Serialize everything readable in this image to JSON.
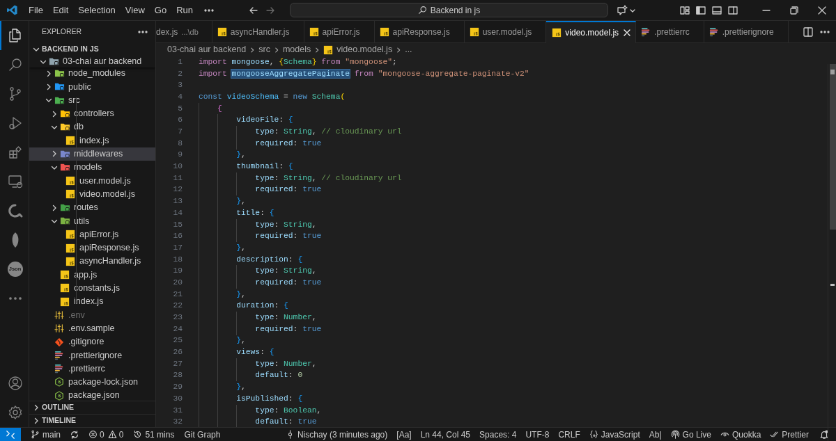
{
  "title_bar": {
    "menus": [
      "File",
      "Edit",
      "Selection",
      "View",
      "Go",
      "Run"
    ],
    "search": "Backend in js"
  },
  "activity_bar": {
    "top": [
      {
        "kind": "explorer",
        "selected": true
      },
      {
        "kind": "search",
        "selected": false
      },
      {
        "kind": "source-control",
        "selected": false
      },
      {
        "kind": "run-debug",
        "selected": false
      },
      {
        "kind": "extensions",
        "selected": false
      },
      {
        "kind": "remote",
        "selected": false
      },
      {
        "kind": "quokka",
        "selected": false
      },
      {
        "kind": "leaf",
        "selected": false
      },
      {
        "kind": "json",
        "label": "Json",
        "selected": false
      },
      {
        "kind": "more",
        "selected": false
      }
    ],
    "bottom": [
      {
        "kind": "account",
        "selected": false
      },
      {
        "kind": "settings",
        "selected": false
      }
    ]
  },
  "sidebar": {
    "title": "EXPLORER",
    "root": "BACKEND IN JS",
    "tree": [
      {
        "label": "03-chai aur backend",
        "kind": "folder",
        "color": "#90a4ae",
        "expanded": true,
        "selected": false,
        "dimmed": false,
        "children": [
          {
            "label": "node_modules",
            "kind": "folder",
            "color": "#8bc34a",
            "expanded": false,
            "selected": false,
            "dimmed": false
          },
          {
            "label": "public",
            "kind": "folder",
            "color": "#2196f3",
            "expanded": false,
            "selected": false,
            "dimmed": false
          },
          {
            "label": "src",
            "kind": "folder",
            "color": "#4caf50",
            "expanded": true,
            "selected": false,
            "dimmed": false,
            "children": [
              {
                "label": "controllers",
                "kind": "folder",
                "color": "#ffc107",
                "expanded": false,
                "selected": false,
                "dimmed": false
              },
              {
                "label": "db",
                "kind": "folder",
                "color": "#ffca28",
                "expanded": true,
                "selected": false,
                "dimmed": false,
                "children": [
                  {
                    "label": "index.js",
                    "kind": "js",
                    "selected": false,
                    "dimmed": false
                  }
                ]
              },
              {
                "label": "middlewares",
                "kind": "folder",
                "color": "#7986cb",
                "expanded": false,
                "selected": true,
                "dimmed": false
              },
              {
                "label": "models",
                "kind": "folder",
                "color": "#ef5350",
                "expanded": true,
                "selected": false,
                "dimmed": false,
                "children": [
                  {
                    "label": "user.model.js",
                    "kind": "js",
                    "selected": false,
                    "dimmed": false
                  },
                  {
                    "label": "video.model.js",
                    "kind": "js",
                    "selected": false,
                    "dimmed": false
                  }
                ]
              },
              {
                "label": "routes",
                "kind": "folder",
                "color": "#43a047",
                "expanded": false,
                "selected": false,
                "dimmed": false
              },
              {
                "label": "utils",
                "kind": "folder",
                "color": "#7cb342",
                "expanded": true,
                "selected": false,
                "dimmed": false,
                "children": [
                  {
                    "label": "apiError.js",
                    "kind": "js",
                    "selected": false,
                    "dimmed": false
                  },
                  {
                    "label": "apiResponse.js",
                    "kind": "js",
                    "selected": false,
                    "dimmed": false
                  },
                  {
                    "label": "asyncHandler.js",
                    "kind": "js",
                    "selected": false,
                    "dimmed": false
                  }
                ]
              },
              {
                "label": "app.js",
                "kind": "js",
                "selected": false,
                "dimmed": false
              },
              {
                "label": "constants.js",
                "kind": "js",
                "selected": false,
                "dimmed": false
              },
              {
                "label": "index.js",
                "kind": "js",
                "selected": false,
                "dimmed": false
              }
            ]
          },
          {
            "label": ".env",
            "kind": "env",
            "selected": false,
            "dimmed": true
          },
          {
            "label": ".env.sample",
            "kind": "env",
            "selected": false,
            "dimmed": false
          },
          {
            "label": ".gitignore",
            "kind": "git",
            "selected": false,
            "dimmed": false
          },
          {
            "label": ".prettierignore",
            "kind": "prettier",
            "selected": false,
            "dimmed": false
          },
          {
            "label": ".prettierrc",
            "kind": "prettier",
            "selected": false,
            "dimmed": false
          },
          {
            "label": "package-lock.json",
            "kind": "json",
            "selected": false,
            "dimmed": false
          },
          {
            "label": "package.json",
            "kind": "json",
            "selected": false,
            "dimmed": false
          }
        ]
      }
    ],
    "sections": [
      {
        "label": "OUTLINE",
        "expanded": false
      },
      {
        "label": "TIMELINE",
        "expanded": false
      }
    ]
  },
  "tabs": [
    {
      "label": "dex.js",
      "description": "...\\db",
      "kind": "partial",
      "selected": false
    },
    {
      "label": "asyncHandler.js",
      "kind": "js",
      "selected": false
    },
    {
      "label": "apiError.js",
      "kind": "js",
      "selected": false
    },
    {
      "label": "apiResponse.js",
      "kind": "js",
      "selected": false
    },
    {
      "label": "user.model.js",
      "kind": "js",
      "selected": false
    },
    {
      "label": "video.model.js",
      "kind": "js",
      "selected": true
    },
    {
      "label": ".prettierrc",
      "kind": "prettier",
      "selected": false
    },
    {
      "label": ".prettierignore",
      "kind": "prettier",
      "selected": false
    }
  ],
  "breadcrumbs": [
    {
      "text": "03-chai aur backend",
      "kind": "folder"
    },
    {
      "text": "src",
      "kind": "folder"
    },
    {
      "text": "models",
      "kind": "folder"
    },
    {
      "text": "video.model.js",
      "kind": "js"
    },
    {
      "text": "...",
      "kind": "symbol"
    }
  ],
  "code_lines": [
    {
      "number": "1",
      "tokens": [
        {
          "kind": "keyword",
          "text": "import "
        },
        {
          "kind": "variable",
          "text": "mongoose"
        },
        {
          "kind": "punct",
          "text": ", "
        },
        {
          "kind": "bracket1",
          "text": "{"
        },
        {
          "kind": "type",
          "text": "Schema"
        },
        {
          "kind": "bracket1",
          "text": "}"
        },
        {
          "kind": "keyword",
          "text": " from "
        },
        {
          "kind": "string",
          "text": "\"mongoose\""
        },
        {
          "kind": "punct",
          "text": ";"
        }
      ]
    },
    {
      "number": "2",
      "tokens": [
        {
          "kind": "keyword",
          "text": "import "
        },
        {
          "kind": "match",
          "text": "mongooseAggregatePaginate"
        },
        {
          "kind": "keyword",
          "text": " from "
        },
        {
          "kind": "string",
          "text": "\"mongoose-aggregate-paginate-v2\""
        }
      ]
    },
    {
      "number": "3"
    },
    {
      "number": "4",
      "tokens": [
        {
          "kind": "storage",
          "text": "const "
        },
        {
          "kind": "constant",
          "text": "videoSchema"
        },
        {
          "kind": "punct",
          "text": " = "
        },
        {
          "kind": "storage",
          "text": "new "
        },
        {
          "kind": "type",
          "text": "Schema"
        },
        {
          "kind": "bracket1",
          "text": "("
        }
      ]
    },
    {
      "number": "5",
      "tokens": [
        {
          "kind": "bracket2",
          "text": "    {"
        }
      ]
    },
    {
      "number": "6",
      "tokens": [
        {
          "kind": "property",
          "text": "        videoFile"
        },
        {
          "kind": "punct",
          "text": ": "
        },
        {
          "kind": "bracket3",
          "text": "{"
        }
      ]
    },
    {
      "number": "7",
      "tokens": [
        {
          "kind": "property",
          "text": "            type"
        },
        {
          "kind": "punct",
          "text": ": "
        },
        {
          "kind": "type",
          "text": "String"
        },
        {
          "kind": "punct",
          "text": ", "
        },
        {
          "kind": "comment",
          "text": "// cloudinary url"
        }
      ]
    },
    {
      "number": "8",
      "tokens": [
        {
          "kind": "property",
          "text": "            required"
        },
        {
          "kind": "punct",
          "text": ": "
        },
        {
          "kind": "boolean",
          "text": "true"
        }
      ]
    },
    {
      "number": "9",
      "tokens": [
        {
          "kind": "bracket3",
          "text": "        }"
        },
        {
          "kind": "punct",
          "text": ","
        }
      ]
    },
    {
      "number": "10",
      "tokens": [
        {
          "kind": "property",
          "text": "        thumbnail"
        },
        {
          "kind": "punct",
          "text": ": "
        },
        {
          "kind": "bracket3",
          "text": "{"
        }
      ]
    },
    {
      "number": "11",
      "tokens": [
        {
          "kind": "property",
          "text": "            type"
        },
        {
          "kind": "punct",
          "text": ": "
        },
        {
          "kind": "type",
          "text": "String"
        },
        {
          "kind": "punct",
          "text": ", "
        },
        {
          "kind": "comment",
          "text": "// cloudinary url"
        }
      ]
    },
    {
      "number": "12",
      "tokens": [
        {
          "kind": "property",
          "text": "            required"
        },
        {
          "kind": "punct",
          "text": ": "
        },
        {
          "kind": "boolean",
          "text": "true"
        }
      ]
    },
    {
      "number": "13",
      "tokens": [
        {
          "kind": "bracket3",
          "text": "        }"
        },
        {
          "kind": "punct",
          "text": ","
        }
      ]
    },
    {
      "number": "14",
      "tokens": [
        {
          "kind": "property",
          "text": "        title"
        },
        {
          "kind": "punct",
          "text": ": "
        },
        {
          "kind": "bracket3",
          "text": "{"
        }
      ]
    },
    {
      "number": "15",
      "tokens": [
        {
          "kind": "property",
          "text": "            type"
        },
        {
          "kind": "punct",
          "text": ": "
        },
        {
          "kind": "type",
          "text": "String"
        },
        {
          "kind": "punct",
          "text": ","
        }
      ]
    },
    {
      "number": "16",
      "tokens": [
        {
          "kind": "property",
          "text": "            required"
        },
        {
          "kind": "punct",
          "text": ": "
        },
        {
          "kind": "boolean",
          "text": "true"
        }
      ]
    },
    {
      "number": "17",
      "tokens": [
        {
          "kind": "bracket3",
          "text": "        }"
        },
        {
          "kind": "punct",
          "text": ","
        }
      ]
    },
    {
      "number": "18",
      "tokens": [
        {
          "kind": "property",
          "text": "        description"
        },
        {
          "kind": "punct",
          "text": ": "
        },
        {
          "kind": "bracket3",
          "text": "{"
        }
      ]
    },
    {
      "number": "19",
      "tokens": [
        {
          "kind": "property",
          "text": "            type"
        },
        {
          "kind": "punct",
          "text": ": "
        },
        {
          "kind": "type",
          "text": "String"
        },
        {
          "kind": "punct",
          "text": ","
        }
      ]
    },
    {
      "number": "20",
      "tokens": [
        {
          "kind": "property",
          "text": "            required"
        },
        {
          "kind": "punct",
          "text": ": "
        },
        {
          "kind": "boolean",
          "text": "true"
        }
      ]
    },
    {
      "number": "21",
      "tokens": [
        {
          "kind": "bracket3",
          "text": "        }"
        },
        {
          "kind": "punct",
          "text": ","
        }
      ]
    },
    {
      "number": "22",
      "tokens": [
        {
          "kind": "property",
          "text": "        duration"
        },
        {
          "kind": "punct",
          "text": ": "
        },
        {
          "kind": "bracket3",
          "text": "{"
        }
      ]
    },
    {
      "number": "23",
      "tokens": [
        {
          "kind": "property",
          "text": "            type"
        },
        {
          "kind": "punct",
          "text": ": "
        },
        {
          "kind": "type",
          "text": "Number"
        },
        {
          "kind": "punct",
          "text": ","
        }
      ]
    },
    {
      "number": "24",
      "tokens": [
        {
          "kind": "property",
          "text": "            required"
        },
        {
          "kind": "punct",
          "text": ": "
        },
        {
          "kind": "boolean",
          "text": "true"
        }
      ]
    },
    {
      "number": "25",
      "tokens": [
        {
          "kind": "bracket3",
          "text": "        }"
        },
        {
          "kind": "punct",
          "text": ","
        }
      ]
    },
    {
      "number": "26",
      "tokens": [
        {
          "kind": "property",
          "text": "        views"
        },
        {
          "kind": "punct",
          "text": ": "
        },
        {
          "kind": "bracket3",
          "text": "{"
        }
      ]
    },
    {
      "number": "27",
      "tokens": [
        {
          "kind": "property",
          "text": "            type"
        },
        {
          "kind": "punct",
          "text": ": "
        },
        {
          "kind": "type",
          "text": "Number"
        },
        {
          "kind": "punct",
          "text": ","
        }
      ]
    },
    {
      "number": "28",
      "tokens": [
        {
          "kind": "property",
          "text": "            default"
        },
        {
          "kind": "punct",
          "text": ": "
        },
        {
          "kind": "number",
          "text": "0"
        }
      ]
    },
    {
      "number": "29",
      "tokens": [
        {
          "kind": "bracket3",
          "text": "        }"
        },
        {
          "kind": "punct",
          "text": ","
        }
      ]
    },
    {
      "number": "30",
      "tokens": [
        {
          "kind": "property",
          "text": "        isPublished"
        },
        {
          "kind": "punct",
          "text": ": "
        },
        {
          "kind": "bracket3",
          "text": "{"
        }
      ]
    },
    {
      "number": "31",
      "tokens": [
        {
          "kind": "property",
          "text": "            type"
        },
        {
          "kind": "punct",
          "text": ": "
        },
        {
          "kind": "type",
          "text": "Boolean"
        },
        {
          "kind": "punct",
          "text": ","
        }
      ]
    },
    {
      "number": "32",
      "tokens": [
        {
          "kind": "property",
          "text": "            default"
        },
        {
          "kind": "punct",
          "text": ": "
        },
        {
          "kind": "boolean",
          "text": "true"
        }
      ]
    }
  ],
  "status_bar": {
    "left": [
      {
        "kind": "remote"
      },
      {
        "kind": "branch",
        "text": "main"
      },
      {
        "kind": "sync"
      },
      {
        "kind": "problems",
        "errors": "0",
        "warnings": "0"
      },
      {
        "kind": "history",
        "text": "51 mins"
      },
      {
        "kind": "text",
        "text": "Git Graph"
      }
    ],
    "right": [
      {
        "kind": "commit",
        "text": "Nischay (3 minutes ago)"
      },
      {
        "kind": "text",
        "text": "[Aa]"
      },
      {
        "kind": "text",
        "text": "Ln 44, Col 45"
      },
      {
        "kind": "text",
        "text": "Spaces: 4"
      },
      {
        "kind": "text",
        "text": "UTF-8"
      },
      {
        "kind": "text",
        "text": "CRLF"
      },
      {
        "kind": "language",
        "text": "JavaScript"
      },
      {
        "kind": "text",
        "text": "Ab|"
      },
      {
        "kind": "broadcast",
        "text": "Go Live"
      },
      {
        "kind": "eye",
        "text": "Quokka"
      },
      {
        "kind": "checks",
        "text": "Prettier"
      },
      {
        "kind": "bell"
      }
    ]
  }
}
